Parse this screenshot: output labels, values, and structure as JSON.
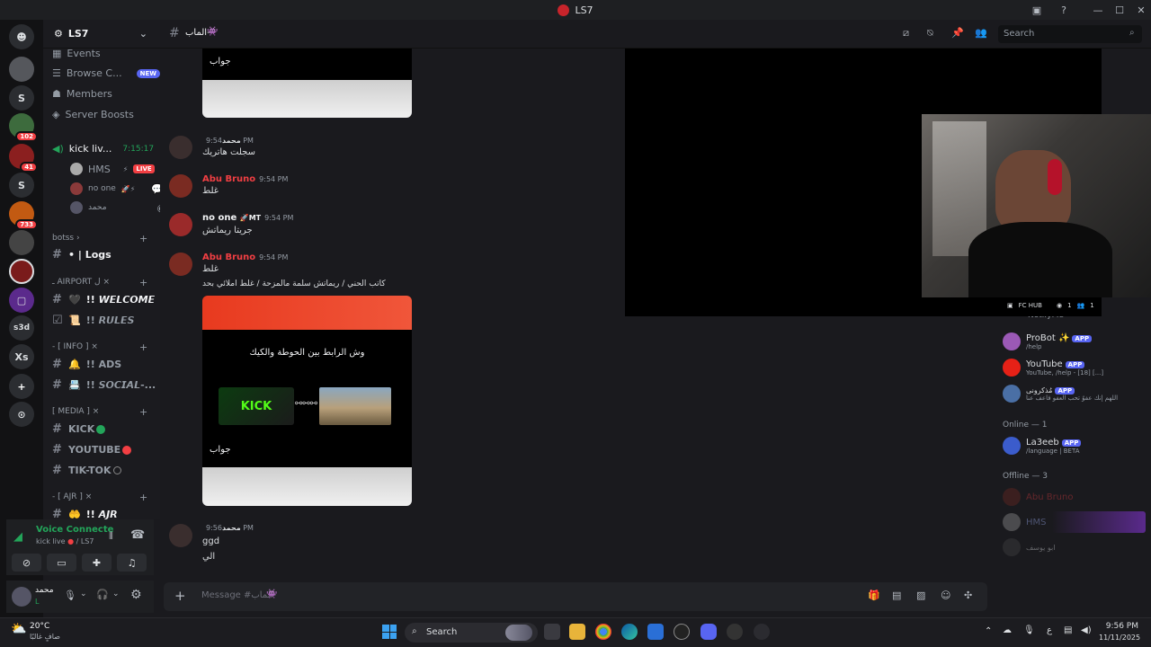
{
  "window": {
    "title": "LS7"
  },
  "server": {
    "name": "LS7"
  },
  "rail": {
    "badges": [
      "102",
      "41",
      "733"
    ],
    "letters": [
      "S",
      "S",
      "s3d",
      "Xs"
    ]
  },
  "channels": {
    "top": [
      {
        "label": "Events"
      },
      {
        "label": "Browse C...",
        "badge": "NEW"
      },
      {
        "label": "Members"
      },
      {
        "label": "Server Boosts"
      }
    ],
    "voice_channel": {
      "name": "kick liv...",
      "timer": "7:15:17"
    },
    "voice_users": [
      {
        "name": "HMS",
        "tag": "LIVE"
      },
      {
        "name": "no one"
      },
      {
        "name": "محمد"
      }
    ],
    "categories": [
      {
        "label": "botss"
      },
      {
        "label": "ـ AIRPORT ل ×"
      },
      {
        "label": "- [ INFO ] ×"
      },
      {
        "label": "[ MEDIA ] ×"
      },
      {
        "label": "- [ AJR ] ×"
      }
    ],
    "items": [
      "• | Logs",
      "!! 𝙒𝙀𝙇𝘾𝙊𝙈𝙀",
      "!! 𝙍𝙐𝙇𝙀𝙎",
      "!! ADS",
      "!! 𝙎𝙊𝘾𝙄𝘼𝙇-...",
      "KICK",
      "YOUTUBE",
      "TIK-TOK",
      "!! 𝘼𝙅𝙍"
    ]
  },
  "voice_panel": {
    "status": "Voice Connecte",
    "sub": "kick live",
    "server": "/ LS7"
  },
  "user_panel": {
    "name": "محمد",
    "status": "L"
  },
  "chat": {
    "channel": "الماب-",
    "search_placeholder": "Search",
    "messages": [
      {
        "author": "محمد",
        "time": "9:54 PM",
        "text": "سجلت هاتريك",
        "color": "#dbdee1"
      },
      {
        "author": "Abu Bruno",
        "time": "9:54 PM",
        "text": "غلط",
        "color": "#f23f43"
      },
      {
        "author": "no one",
        "tag": "MT",
        "time": "9:54 PM",
        "text": "جريتا ريماتش",
        "color": "#f2f3f5"
      },
      {
        "author": "Abu Bruno",
        "time": "9:54 PM",
        "text": "غلط",
        "text2": "كاتب الحني / ريماتش سلمة مالمزحة / غلط املائي بحد",
        "color": "#f23f43"
      },
      {
        "author": "محمد",
        "time": "9:56 PM",
        "text": "ggd",
        "text2": "الي",
        "color": "#dbdee1"
      }
    ],
    "embed1_answer": "جواب",
    "embed2": {
      "question": "وش الرابط بين الحوطة والكيك",
      "kick_label": "KICK",
      "answer": "جواب"
    },
    "input_placeholder": "Message #الماب-"
  },
  "stream": {
    "label": "FC HUB",
    "count1": "1",
    "count2": "1"
  },
  "members": {
    "top_cut": "NotifyMe",
    "bots": [
      {
        "name": "ProBot ✨",
        "sub": "/help",
        "color": "#9b59b6"
      },
      {
        "name": "YouTube",
        "sub": "YouTube, /help - [18] [...]",
        "color": "#e62117"
      },
      {
        "name": "مُذكرونى",
        "sub": "اللهم إنك عفوٌ تحب العفو فاعف عنا",
        "color": "#4a6fa5"
      }
    ],
    "online_header": "Online — 1",
    "online": [
      {
        "name": "La3eeb",
        "sub": "/language | BETA"
      }
    ],
    "offline_header": "Offline — 3",
    "offline": [
      "Abu Bruno",
      "HMS",
      "ابو يوسف"
    ]
  },
  "taskbar": {
    "weather_temp": "20°C",
    "weather_desc": "صافٍ غالبًا",
    "search": "Search",
    "lang": "ع",
    "time": "9:56 PM",
    "date": "11/11/2025"
  },
  "app_tag": "APP"
}
